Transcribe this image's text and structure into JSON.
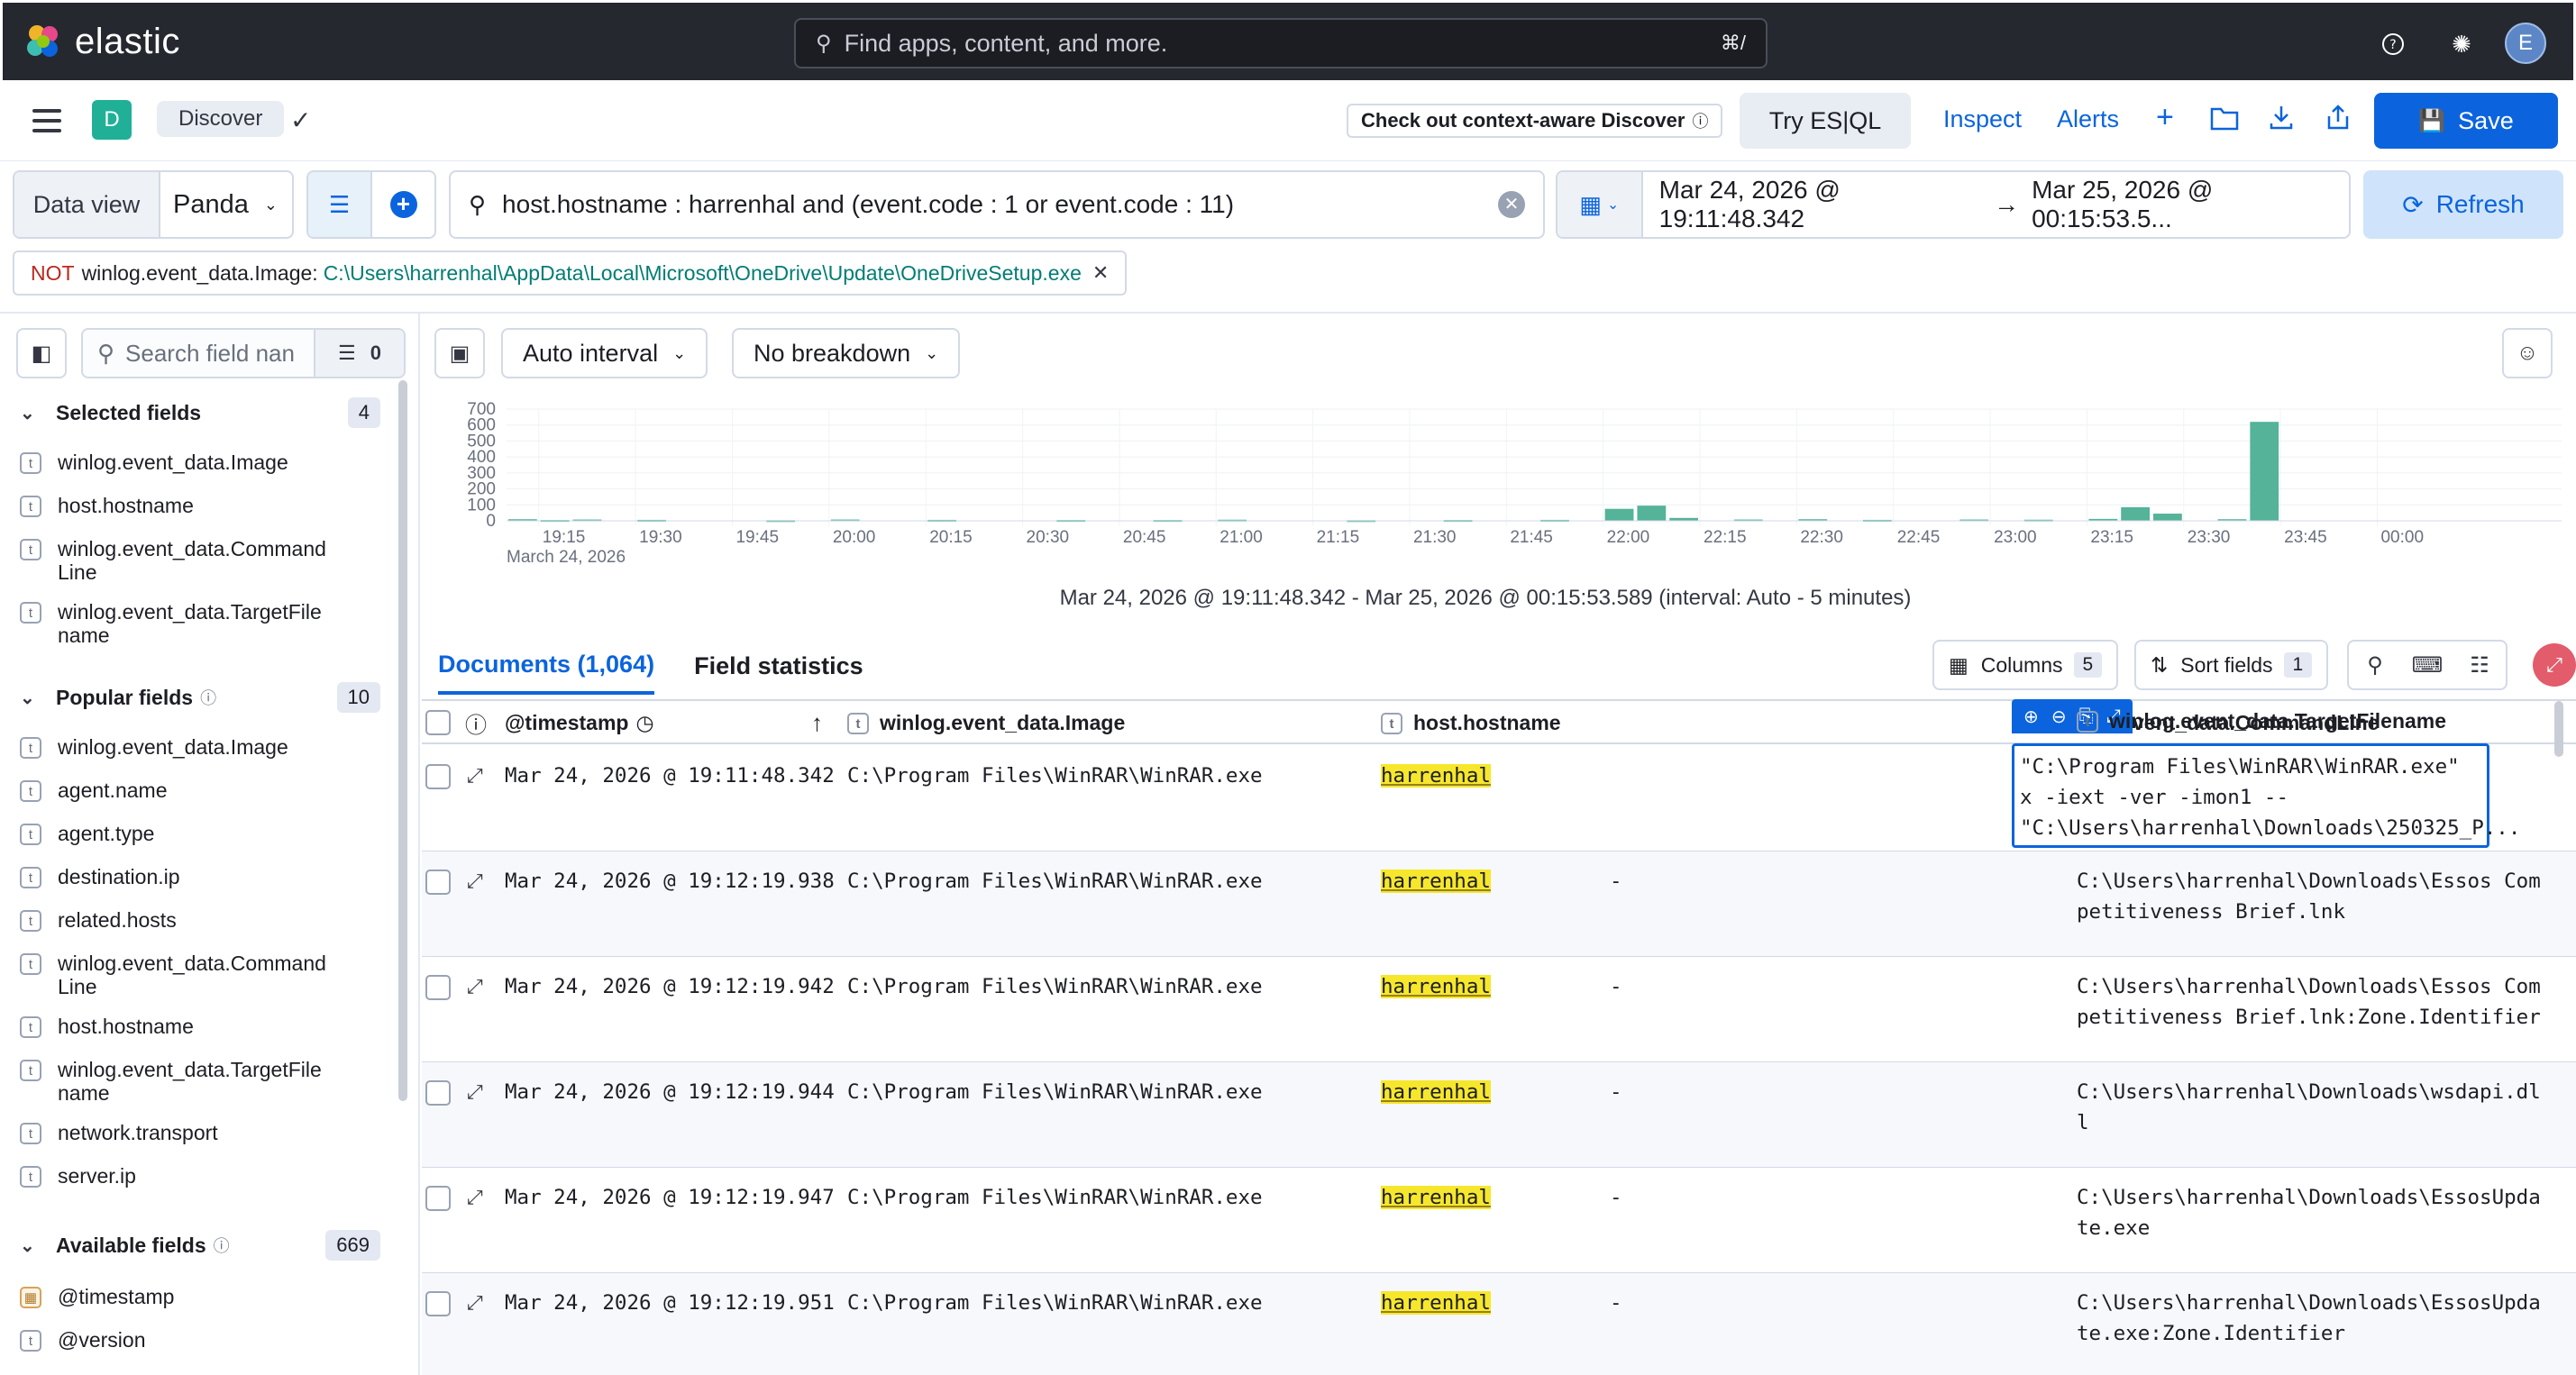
{
  "header": {
    "brand": "elastic",
    "search_placeholder": "Find apps, content, and more.",
    "search_shortcut": "⌘/",
    "avatar_initial": "E"
  },
  "appbar": {
    "space_badge": "D",
    "breadcrumb": "Discover",
    "context_aware": "Check out context-aware Discover",
    "try_esql": "Try ES|QL",
    "inspect": "Inspect",
    "alerts": "Alerts",
    "save": "Save"
  },
  "querybar": {
    "data_view_label": "Data view",
    "data_view_value": "Panda",
    "query": "host.hostname : harrenhal and (event.code : 1  or event.code : 11)",
    "date_start": "Mar 24, 2026 @ 19:11:48.342",
    "date_end": "Mar 25, 2026 @ 00:15:53.5...",
    "refresh": "Refresh"
  },
  "filter_pill": {
    "negate": "NOT",
    "field": "winlog.event_data.Image:",
    "value": "C:\\Users\\harrenhal\\AppData\\Local\\Microsoft\\OneDrive\\Update\\OneDriveSetup.exe"
  },
  "sidebar": {
    "search_placeholder": "Search field nan",
    "filter_count": "0",
    "selected": {
      "title": "Selected fields",
      "count": "4",
      "items": [
        "winlog.event_data.Image",
        "host.hostname",
        "winlog.event_data.CommandLine",
        "winlog.event_data.TargetFilename"
      ]
    },
    "popular": {
      "title": "Popular fields",
      "count": "10",
      "items": [
        "winlog.event_data.Image",
        "agent.name",
        "agent.type",
        "destination.ip",
        "related.hosts",
        "winlog.event_data.CommandLine",
        "host.hostname",
        "winlog.event_data.TargetFilename",
        "network.transport",
        "server.ip"
      ]
    },
    "available": {
      "title": "Available fields",
      "count": "669",
      "items": [
        "@timestamp",
        "@version"
      ]
    }
  },
  "chart_controls": {
    "interval": "Auto interval",
    "breakdown": "No breakdown"
  },
  "chart_data": {
    "type": "bar",
    "ylim": [
      0,
      700
    ],
    "y_ticks": [
      "700",
      "600",
      "500",
      "400",
      "300",
      "200",
      "100",
      "0"
    ],
    "x_ticks": [
      "19:15",
      "19:30",
      "19:45",
      "20:00",
      "20:15",
      "20:30",
      "20:45",
      "21:00",
      "21:15",
      "21:30",
      "21:45",
      "22:00",
      "22:15",
      "22:30",
      "22:45",
      "23:00",
      "23:15",
      "23:30",
      "23:45",
      "00:00"
    ],
    "x_sub_label": "March 24, 2026",
    "bar_color": "#54b399",
    "bars": [
      {
        "t": "19:10",
        "v": 10
      },
      {
        "t": "19:15",
        "v": 5
      },
      {
        "t": "19:20",
        "v": 8
      },
      {
        "t": "19:30",
        "v": 6
      },
      {
        "t": "19:50",
        "v": 4
      },
      {
        "t": "20:00",
        "v": 8
      },
      {
        "t": "20:15",
        "v": 6
      },
      {
        "t": "20:35",
        "v": 5
      },
      {
        "t": "20:50",
        "v": 5
      },
      {
        "t": "21:00",
        "v": 7
      },
      {
        "t": "21:20",
        "v": 4
      },
      {
        "t": "21:35",
        "v": 5
      },
      {
        "t": "21:50",
        "v": 6
      },
      {
        "t": "22:00",
        "v": 75
      },
      {
        "t": "22:05",
        "v": 95
      },
      {
        "t": "22:10",
        "v": 18
      },
      {
        "t": "22:20",
        "v": 8
      },
      {
        "t": "22:30",
        "v": 10
      },
      {
        "t": "22:40",
        "v": 6
      },
      {
        "t": "22:55",
        "v": 8
      },
      {
        "t": "23:05",
        "v": 7
      },
      {
        "t": "23:15",
        "v": 12
      },
      {
        "t": "23:20",
        "v": 85
      },
      {
        "t": "23:25",
        "v": 45
      },
      {
        "t": "23:35",
        "v": 10
      },
      {
        "t": "23:40",
        "v": 620
      }
    ],
    "caption": "Mar 24, 2026 @ 19:11:48.342 - Mar 25, 2026 @ 00:15:53.589 (interval: Auto - 5 minutes)"
  },
  "tabs": {
    "documents": "Documents (1,064)",
    "field_stats": "Field statistics"
  },
  "toolbar": {
    "columns": "Columns",
    "columns_count": "5",
    "sort": "Sort fields",
    "sort_count": "1"
  },
  "grid": {
    "headers": [
      "@timestamp",
      "winlog.event_data.Image",
      "host.hostname",
      "winlog.event_data.CommandLine",
      "winlog.event_data.TargetFilename"
    ],
    "header_cmd_visible": "vent_data.CommandLine",
    "rows": [
      {
        "ts": "Mar 24, 2026 @ 19:11:48.342",
        "image": "C:\\Program Files\\WinRAR\\WinRAR.exe",
        "host": "harrenhal",
        "cmd": "\"C:\\Program Files\\WinRAR\\WinRAR.exe\" x -iext -ver -imon1 -- \"C:\\Users\\harrenhal\\Downloads\\250325_P...",
        "target": "-"
      },
      {
        "ts": "Mar 24, 2026 @ 19:12:19.938",
        "image": "C:\\Program Files\\WinRAR\\WinRAR.exe",
        "host": "harrenhal",
        "cmd": "-",
        "target": "C:\\Users\\harrenhal\\Downloads\\Essos Competitiveness Brief.lnk"
      },
      {
        "ts": "Mar 24, 2026 @ 19:12:19.942",
        "image": "C:\\Program Files\\WinRAR\\WinRAR.exe",
        "host": "harrenhal",
        "cmd": "-",
        "target": "C:\\Users\\harrenhal\\Downloads\\Essos Competitiveness Brief.lnk:Zone.Identifier"
      },
      {
        "ts": "Mar 24, 2026 @ 19:12:19.944",
        "image": "C:\\Program Files\\WinRAR\\WinRAR.exe",
        "host": "harrenhal",
        "cmd": "-",
        "target": "C:\\Users\\harrenhal\\Downloads\\wsdapi.dll"
      },
      {
        "ts": "Mar 24, 2026 @ 19:12:19.947",
        "image": "C:\\Program Files\\WinRAR\\WinRAR.exe",
        "host": "harrenhal",
        "cmd": "-",
        "target": "C:\\Users\\harrenhal\\Downloads\\EssosUpdate.exe"
      },
      {
        "ts": "Mar 24, 2026 @ 19:12:19.951",
        "image": "C:\\Program Files\\WinRAR\\WinRAR.exe",
        "host": "harrenhal",
        "cmd": "-",
        "target": "C:\\Users\\harrenhal\\Downloads\\EssosUpdate.exe:Zone.Identifier"
      }
    ]
  }
}
